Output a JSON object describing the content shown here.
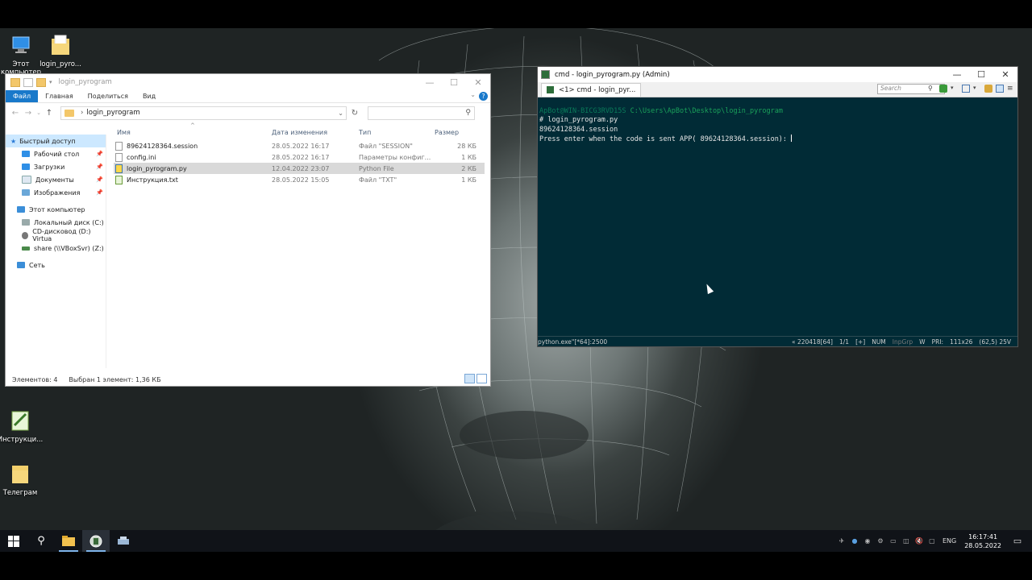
{
  "desktop": {
    "icons": [
      {
        "label": "Этот компьютер",
        "icon": "monitor-icon"
      },
      {
        "label": "login_pyro...",
        "icon": "folder-icon"
      },
      {
        "label": "Инструкци...",
        "icon": "notepad-icon"
      },
      {
        "label": "Телеграм",
        "icon": "folder-icon"
      }
    ]
  },
  "explorer": {
    "title": "login_pyrogram",
    "ribbon_tabs": [
      "Файл",
      "Главная",
      "Поделиться",
      "Вид"
    ],
    "address": "login_pyrogram",
    "search_placeholder": "",
    "nav": {
      "quick_access": "Быстрый доступ",
      "quick_items": [
        "Рабочий стол",
        "Загрузки",
        "Документы",
        "Изображения"
      ],
      "this_pc": "Этот компьютер",
      "drives": [
        "Локальный диск (C:)",
        "CD-дисковод (D:) Virtua",
        "share (\\\\VBoxSvr) (Z:)"
      ],
      "network": "Сеть"
    },
    "columns": {
      "name": "Имя",
      "date": "Дата изменения",
      "type": "Тип",
      "size": "Размер"
    },
    "files": [
      {
        "name": "89624128364.session",
        "date": "28.05.2022 16:17",
        "type": "Файл \"SESSION\"",
        "size": "28 КБ",
        "icon": "file-icon"
      },
      {
        "name": "config.ini",
        "date": "28.05.2022 16:17",
        "type": "Параметры конфиг...",
        "size": "1 КБ",
        "icon": "settings-file-icon"
      },
      {
        "name": "login_pyrogram.py",
        "date": "12.04.2022 23:07",
        "type": "Python File",
        "size": "2 КБ",
        "icon": "python-file-icon"
      },
      {
        "name": "Инструкция.txt",
        "date": "28.05.2022 15:05",
        "type": "Файл \"TXT\"",
        "size": "1 КБ",
        "icon": "text-file-icon"
      }
    ],
    "status_count": "Элементов: 4",
    "status_selected": "Выбран 1 элемент: 1,36 КБ"
  },
  "console": {
    "title": "cmd - login_pyrogram.py (Admin)",
    "tab_label": "<1> cmd - login_pyr...",
    "search_placeholder": "Search",
    "prompt_user": "ApBot@WIN-BICG3RVD15S",
    "prompt_path": "C:\\Users\\ApBot\\Desktop\\login_pyrogram",
    "lines": [
      "# login_pyrogram.py",
      "89624128364.session",
      "Press enter when the code is sent APP( 89624128364.session): "
    ],
    "status_left": "python.exe\"[*64]:2500",
    "status_right": [
      "« 220418[64]",
      "1/1",
      "[+]",
      "NUM",
      "InpGrp",
      "W",
      "PRI:",
      "111x26",
      "(62,5) 25V"
    ]
  },
  "taskbar": {
    "lang": "ENG",
    "time": "16:17:41",
    "date": "28.05.2022"
  }
}
